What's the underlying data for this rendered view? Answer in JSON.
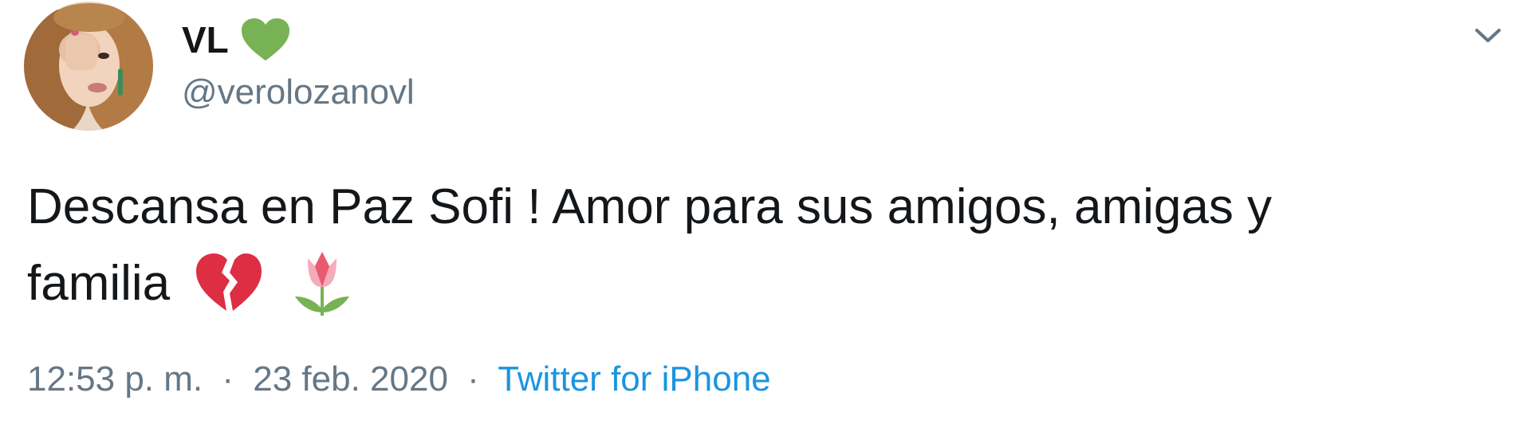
{
  "user": {
    "display_name": "VL",
    "badge_icon": "green-heart-icon",
    "badge_color": "#77b255",
    "handle": "@verolozanovl"
  },
  "tweet": {
    "text_line1": "Descansa en Paz Sofi ! Amor para sus amigos, amigas y",
    "text_line2": "familia",
    "emojis": [
      "broken-heart-icon",
      "tulip-icon"
    ]
  },
  "meta": {
    "time": "12:53 p. m.",
    "date": "23 feb. 2020",
    "separator": "·",
    "source": "Twitter for iPhone"
  },
  "colors": {
    "text": "#14171a",
    "secondary": "#657786",
    "link": "#1b95e0"
  }
}
